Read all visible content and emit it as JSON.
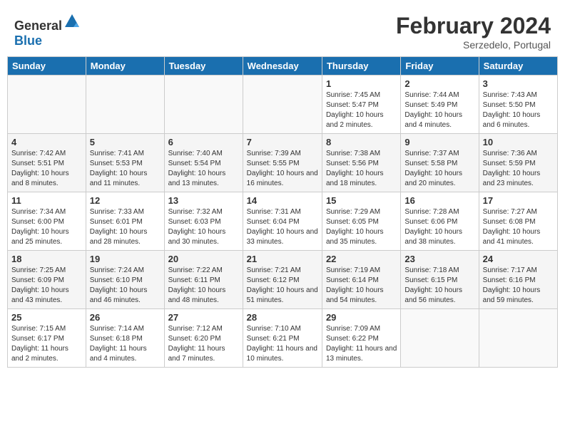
{
  "header": {
    "logo": {
      "text_general": "General",
      "text_blue": "Blue"
    },
    "title": "February 2024",
    "location": "Serzedelo, Portugal"
  },
  "calendar": {
    "days_of_week": [
      "Sunday",
      "Monday",
      "Tuesday",
      "Wednesday",
      "Thursday",
      "Friday",
      "Saturday"
    ],
    "weeks": [
      [
        {
          "day": "",
          "empty": true
        },
        {
          "day": "",
          "empty": true
        },
        {
          "day": "",
          "empty": true
        },
        {
          "day": "",
          "empty": true
        },
        {
          "day": "1",
          "sunrise": "7:45 AM",
          "sunset": "5:47 PM",
          "daylight": "10 hours and 2 minutes."
        },
        {
          "day": "2",
          "sunrise": "7:44 AM",
          "sunset": "5:49 PM",
          "daylight": "10 hours and 4 minutes."
        },
        {
          "day": "3",
          "sunrise": "7:43 AM",
          "sunset": "5:50 PM",
          "daylight": "10 hours and 6 minutes."
        }
      ],
      [
        {
          "day": "4",
          "sunrise": "7:42 AM",
          "sunset": "5:51 PM",
          "daylight": "10 hours and 8 minutes."
        },
        {
          "day": "5",
          "sunrise": "7:41 AM",
          "sunset": "5:53 PM",
          "daylight": "10 hours and 11 minutes."
        },
        {
          "day": "6",
          "sunrise": "7:40 AM",
          "sunset": "5:54 PM",
          "daylight": "10 hours and 13 minutes."
        },
        {
          "day": "7",
          "sunrise": "7:39 AM",
          "sunset": "5:55 PM",
          "daylight": "10 hours and 16 minutes."
        },
        {
          "day": "8",
          "sunrise": "7:38 AM",
          "sunset": "5:56 PM",
          "daylight": "10 hours and 18 minutes."
        },
        {
          "day": "9",
          "sunrise": "7:37 AM",
          "sunset": "5:58 PM",
          "daylight": "10 hours and 20 minutes."
        },
        {
          "day": "10",
          "sunrise": "7:36 AM",
          "sunset": "5:59 PM",
          "daylight": "10 hours and 23 minutes."
        }
      ],
      [
        {
          "day": "11",
          "sunrise": "7:34 AM",
          "sunset": "6:00 PM",
          "daylight": "10 hours and 25 minutes."
        },
        {
          "day": "12",
          "sunrise": "7:33 AM",
          "sunset": "6:01 PM",
          "daylight": "10 hours and 28 minutes."
        },
        {
          "day": "13",
          "sunrise": "7:32 AM",
          "sunset": "6:03 PM",
          "daylight": "10 hours and 30 minutes."
        },
        {
          "day": "14",
          "sunrise": "7:31 AM",
          "sunset": "6:04 PM",
          "daylight": "10 hours and 33 minutes."
        },
        {
          "day": "15",
          "sunrise": "7:29 AM",
          "sunset": "6:05 PM",
          "daylight": "10 hours and 35 minutes."
        },
        {
          "day": "16",
          "sunrise": "7:28 AM",
          "sunset": "6:06 PM",
          "daylight": "10 hours and 38 minutes."
        },
        {
          "day": "17",
          "sunrise": "7:27 AM",
          "sunset": "6:08 PM",
          "daylight": "10 hours and 41 minutes."
        }
      ],
      [
        {
          "day": "18",
          "sunrise": "7:25 AM",
          "sunset": "6:09 PM",
          "daylight": "10 hours and 43 minutes."
        },
        {
          "day": "19",
          "sunrise": "7:24 AM",
          "sunset": "6:10 PM",
          "daylight": "10 hours and 46 minutes."
        },
        {
          "day": "20",
          "sunrise": "7:22 AM",
          "sunset": "6:11 PM",
          "daylight": "10 hours and 48 minutes."
        },
        {
          "day": "21",
          "sunrise": "7:21 AM",
          "sunset": "6:12 PM",
          "daylight": "10 hours and 51 minutes."
        },
        {
          "day": "22",
          "sunrise": "7:19 AM",
          "sunset": "6:14 PM",
          "daylight": "10 hours and 54 minutes."
        },
        {
          "day": "23",
          "sunrise": "7:18 AM",
          "sunset": "6:15 PM",
          "daylight": "10 hours and 56 minutes."
        },
        {
          "day": "24",
          "sunrise": "7:17 AM",
          "sunset": "6:16 PM",
          "daylight": "10 hours and 59 minutes."
        }
      ],
      [
        {
          "day": "25",
          "sunrise": "7:15 AM",
          "sunset": "6:17 PM",
          "daylight": "11 hours and 2 minutes."
        },
        {
          "day": "26",
          "sunrise": "7:14 AM",
          "sunset": "6:18 PM",
          "daylight": "11 hours and 4 minutes."
        },
        {
          "day": "27",
          "sunrise": "7:12 AM",
          "sunset": "6:20 PM",
          "daylight": "11 hours and 7 minutes."
        },
        {
          "day": "28",
          "sunrise": "7:10 AM",
          "sunset": "6:21 PM",
          "daylight": "11 hours and 10 minutes."
        },
        {
          "day": "29",
          "sunrise": "7:09 AM",
          "sunset": "6:22 PM",
          "daylight": "11 hours and 13 minutes."
        },
        {
          "day": "",
          "empty": true
        },
        {
          "day": "",
          "empty": true
        }
      ]
    ],
    "labels": {
      "sunrise": "Sunrise:",
      "sunset": "Sunset:",
      "daylight": "Daylight:"
    }
  }
}
